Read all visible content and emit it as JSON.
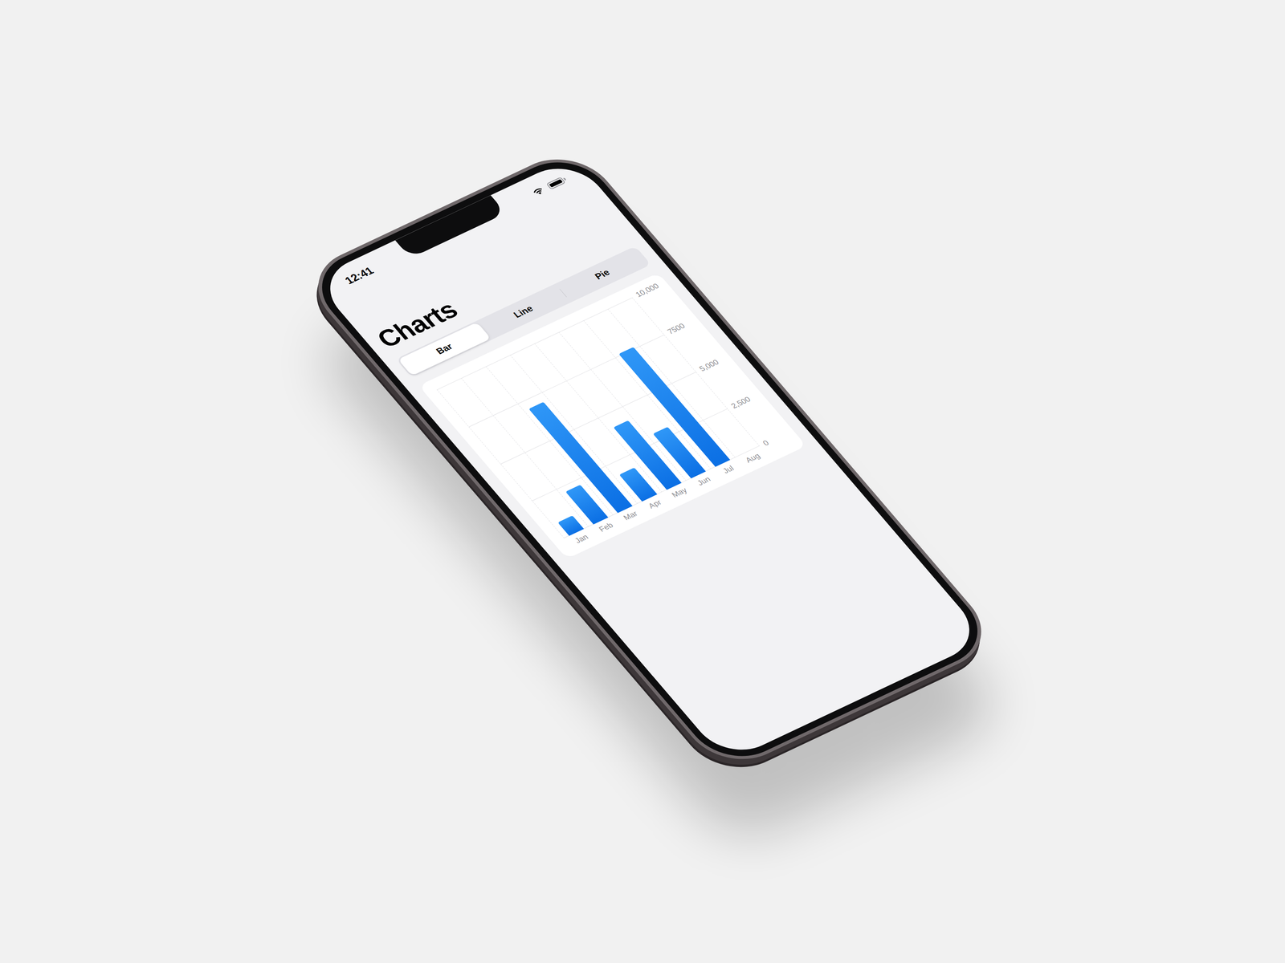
{
  "status_bar": {
    "time": "12:41",
    "battery": {
      "level": 1
    }
  },
  "title": "Charts",
  "tabs": [
    {
      "label": "Bar",
      "selected": true
    },
    {
      "label": "Line",
      "selected": false
    },
    {
      "label": "Pie",
      "selected": false
    }
  ],
  "chart": {
    "y_ticks": [
      "0",
      "2,500",
      "5,000",
      "7500",
      "10,000"
    ],
    "categories": [
      "Jan",
      "Feb",
      "Mar",
      "Apr",
      "May",
      "Jun",
      "Jul",
      "Aug"
    ],
    "series": [
      {
        "values": [
          900,
          2200,
          7000,
          1800,
          4200,
          3000,
          7600,
          0
        ]
      }
    ]
  }
}
